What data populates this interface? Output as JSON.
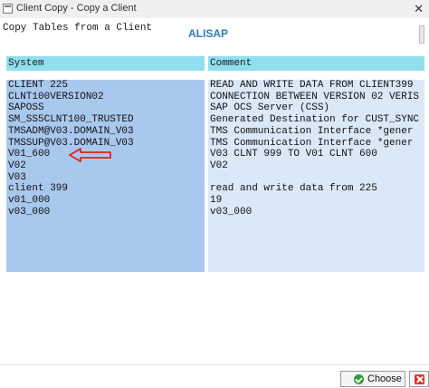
{
  "window": {
    "title": "Client Copy - Copy a Client",
    "close_glyph": "✕"
  },
  "header": {
    "subtitle": "Copy Tables from a Client",
    "watermark": "ALISAP"
  },
  "table": {
    "columns": [
      "System",
      "Comment"
    ],
    "rows": [
      {
        "system": "CLIENT 225",
        "comment": "READ AND WRITE DATA FROM CLIENT399"
      },
      {
        "system": "CLNT100VERSION02",
        "comment": "CONNECTION BETWEEN VERSION 02 VERIS"
      },
      {
        "system": "SAPOSS",
        "comment": "SAP OCS Server (CSS)"
      },
      {
        "system": "SM_SS5CLNT100_TRUSTED",
        "comment": "Generated Destination for CUST_SYNC"
      },
      {
        "system": "TMSADM@V03.DOMAIN_V03",
        "comment": "TMS Communication Interface  *gener"
      },
      {
        "system": "TMSSUP@V03.DOMAIN_V03",
        "comment": "TMS Communication Interface  *gener"
      },
      {
        "system": "V01_600",
        "comment": "V03 CLNT 999 TO V01 CLNT 600"
      },
      {
        "system": "V02",
        "comment": "V02"
      },
      {
        "system": "V03",
        "comment": ""
      },
      {
        "system": "client 399",
        "comment": "read and write data from 225"
      },
      {
        "system": "v01_000",
        "comment": "19"
      },
      {
        "system": "v03_000",
        "comment": "v03_000"
      }
    ]
  },
  "footer": {
    "choose_label": "Choose"
  },
  "icons": {
    "window": "window-icon",
    "choose": "check-icon",
    "cancel": "cancel-icon",
    "annotation": "red-arrow-annotation"
  },
  "colors": {
    "header_bg": "#8fdfee",
    "system_col_bg": "#a9c8ee",
    "comment_col_bg": "#dbe8f8",
    "arrow": "#e0241c",
    "watermark": "#2c7bc6"
  }
}
